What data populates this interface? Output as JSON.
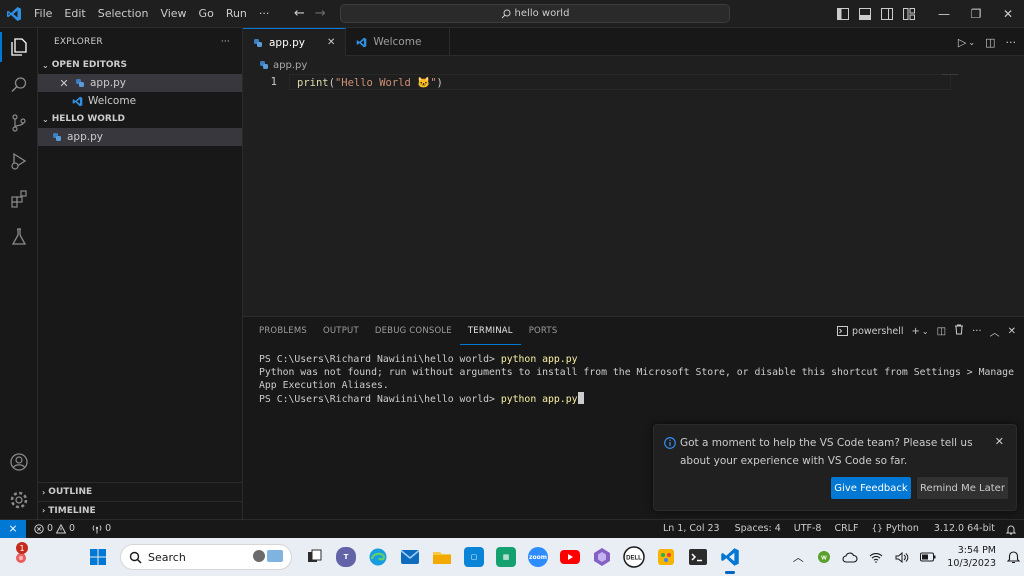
{
  "titlebar": {
    "menu": [
      "File",
      "Edit",
      "Selection",
      "View",
      "Go",
      "Run"
    ],
    "more": "···",
    "search_text": "hello world"
  },
  "explorer": {
    "header": "EXPLORER",
    "more": "···",
    "open_editors_label": "OPEN EDITORS",
    "open_editors": [
      {
        "name": "app.py",
        "kind": "python"
      },
      {
        "name": "Welcome",
        "kind": "vscode"
      }
    ],
    "folder_label": "HELLO WORLD",
    "files": [
      {
        "name": "app.py"
      }
    ],
    "outline_label": "OUTLINE",
    "timeline_label": "TIMELINE"
  },
  "tabs": [
    {
      "label": "app.py",
      "active": true
    },
    {
      "label": "Welcome",
      "active": false
    }
  ],
  "editor": {
    "breadcrumb": "app.py",
    "line_number": "1",
    "code_fn": "print",
    "code_open": "(",
    "code_str": "\"Hello World 🐱\"",
    "code_close": ")"
  },
  "panel": {
    "tabs": [
      "PROBLEMS",
      "OUTPUT",
      "DEBUG CONSOLE",
      "TERMINAL",
      "PORTS"
    ],
    "active_tab": "TERMINAL",
    "shell": "powershell",
    "terminal": {
      "prompt1": "PS C:\\Users\\Richard Nawiini\\hello world> ",
      "cmd1": "python app.py",
      "output": "Python was not found; run without arguments to install from the Microsoft Store, or disable this shortcut from Settings > Manage App Execution Aliases.",
      "prompt2": "PS C:\\Users\\Richard Nawiini\\hello world> ",
      "cmd2": "python app.py"
    }
  },
  "notification": {
    "message": "Got a moment to help the VS Code team? Please tell us about your experience with VS Code so far.",
    "primary": "Give Feedback",
    "secondary": "Remind Me Later"
  },
  "statusbar": {
    "errors": "0",
    "warnings": "0",
    "ports": "0",
    "position": "Ln 1, Col 23",
    "spaces": "Spaces: 4",
    "encoding": "UTF-8",
    "eol": "CRLF",
    "language": "Python",
    "interpreter": "3.12.0 64-bit"
  },
  "taskbar": {
    "search_label": "Search",
    "weather_badge": "1",
    "time": "3:54 PM",
    "date": "10/3/2023"
  },
  "colors": {
    "accent": "#0078d4",
    "python_blue": "#3c7ebf",
    "vscode_blue": "#2f8fe0"
  }
}
